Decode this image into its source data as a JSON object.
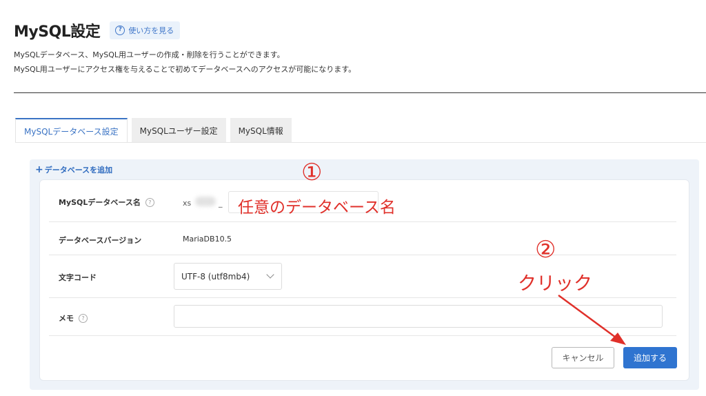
{
  "header": {
    "title": "MySQL設定",
    "help_label": "使い方を見る"
  },
  "description": {
    "line1": "MySQLデータベース、MySQL用ユーザーの作成・削除を行うことができます。",
    "line2": "MySQL用ユーザーにアクセス権を与えることで初めてデータベースへのアクセスが可能になります。"
  },
  "tabs": [
    {
      "label": "MySQLデータベース設定",
      "active": true
    },
    {
      "label": "MySQLユーザー設定",
      "active": false
    },
    {
      "label": "MySQL情報",
      "active": false
    }
  ],
  "panel": {
    "title": "データベースを追加"
  },
  "form": {
    "db_name_label": "MySQLデータベース名",
    "db_prefix": "xs",
    "db_separator": "_",
    "db_name_value": "",
    "version_label": "データベースバージョン",
    "version_value": "MariaDB10.5",
    "charset_label": "文字コード",
    "charset_value": "UTF-8 (utf8mb4)",
    "memo_label": "メモ",
    "memo_value": ""
  },
  "buttons": {
    "cancel": "キャンセル",
    "add": "追加する"
  },
  "annotations": {
    "step1": "①",
    "db_name_hint": "任意のデータベース名",
    "step2": "②",
    "click": "クリック"
  },
  "colors": {
    "accent": "#2f74d0",
    "annotation": "#e0302a",
    "panel_bg": "#eef3f9"
  }
}
